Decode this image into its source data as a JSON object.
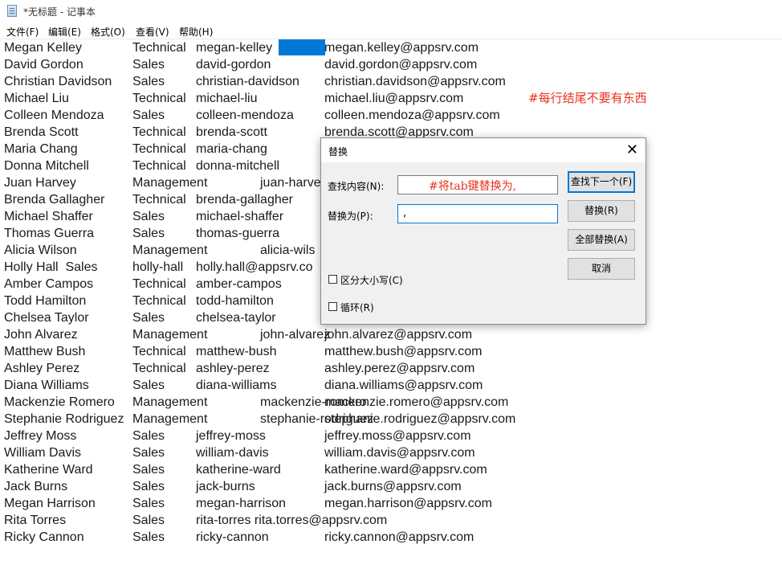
{
  "window": {
    "title": "*无标题 - 记事本"
  },
  "menu": [
    "文件(F)",
    "编辑(E)",
    "格式(O)",
    "查看(V)",
    "帮助(H)"
  ],
  "rows": [
    [
      "Megan Kelley",
      "Technical",
      "megan-kelley",
      "",
      "megan.kelley@appsrv.com"
    ],
    [
      "David Gordon",
      "Sales",
      "david-gordon",
      "",
      "david.gordon@appsrv.com"
    ],
    [
      "Christian Davidson",
      "Sales",
      "christian-davidson",
      "",
      "christian.davidson@appsrv.com"
    ],
    [
      "Michael Liu",
      "Technical",
      "michael-liu",
      "",
      "michael.liu@appsrv.com"
    ],
    [
      "Colleen Mendoza",
      "Sales",
      "colleen-mendoza",
      "",
      "colleen.mendoza@appsrv.com"
    ],
    [
      "Brenda Scott",
      "Technical",
      "brenda-scott",
      "",
      "brenda.scott@appsrv.com"
    ],
    [
      "Maria Chang",
      "Technical",
      "maria-chang",
      "",
      ""
    ],
    [
      "Donna Mitchell",
      "Technical",
      "donna-mitchell",
      "",
      ""
    ],
    [
      "Juan Harvey",
      "Management",
      "",
      "juan-harve",
      ""
    ],
    [
      "Brenda Gallagher",
      "Technical",
      "brenda-gallagher",
      "",
      ""
    ],
    [
      "Michael Shaffer",
      "Sales",
      "michael-shaffer",
      "",
      ""
    ],
    [
      "Thomas Guerra",
      "Sales",
      "thomas-guerra",
      "",
      ""
    ],
    [
      "Alicia Wilson",
      "Management",
      "",
      "alicia-wils",
      ""
    ],
    [
      "Holly Hall  Sales",
      "holly-hall",
      "holly.hall@appsrv.co",
      "",
      ""
    ],
    [
      "Amber Campos",
      "Technical",
      "amber-campos",
      "",
      ""
    ],
    [
      "Todd Hamilton",
      "Technical",
      "todd-hamilton",
      "",
      ""
    ],
    [
      "Chelsea Taylor",
      "Sales",
      "chelsea-taylor",
      "",
      ""
    ],
    [
      "John Alvarez",
      "Management",
      "",
      "john-alvarez",
      "john.alvarez@appsrv.com"
    ],
    [
      "Matthew Bush",
      "Technical",
      "matthew-bush",
      "",
      "matthew.bush@appsrv.com"
    ],
    [
      "Ashley Perez",
      "Technical",
      "ashley-perez",
      "",
      "ashley.perez@appsrv.com"
    ],
    [
      "Diana Williams",
      "Sales",
      "diana-williams",
      "",
      "diana.williams@appsrv.com"
    ],
    [
      "Mackenzie Romero",
      "Management",
      "",
      "mackenzie-romero",
      "mackenzie.romero@appsrv.com"
    ],
    [
      "Stephanie Rodriguez",
      "Management",
      "",
      "stephanie-rodriguez",
      "stephanie.rodriguez@appsrv.com"
    ],
    [
      "Jeffrey Moss",
      "Sales",
      "jeffrey-moss",
      "",
      "jeffrey.moss@appsrv.com"
    ],
    [
      "William Davis",
      "Sales",
      "william-davis",
      "",
      "william.davis@appsrv.com"
    ],
    [
      "Katherine Ward",
      "Sales",
      "katherine-ward",
      "",
      "katherine.ward@appsrv.com"
    ],
    [
      "Jack Burns",
      "Sales",
      "jack-burns",
      "",
      "jack.burns@appsrv.com"
    ],
    [
      "Megan Harrison",
      "Sales",
      "megan-harrison",
      "",
      "megan.harrison@appsrv.com"
    ],
    [
      "Rita Torres",
      "Sales",
      "rita-torres rita.torres@appsrv.com",
      "",
      ""
    ],
    [
      "Ricky Cannon",
      "Sales",
      "ricky-cannon",
      "",
      "ricky.cannon@appsrv.com"
    ]
  ],
  "comment": "#每行结尾不要有东西",
  "dialog": {
    "title": "替换",
    "close": "✕",
    "find_label": "查找内容(N):",
    "find_value": "#将tab键替换为,",
    "replace_label": "替换为(P):",
    "replace_value": ",",
    "find_next": "查找下一个(F)",
    "replace": "替换(R)",
    "replace_all": "全部替换(A)",
    "cancel": "取消",
    "match_case": "区分大小写(C)",
    "wrap": "循环(R)"
  }
}
